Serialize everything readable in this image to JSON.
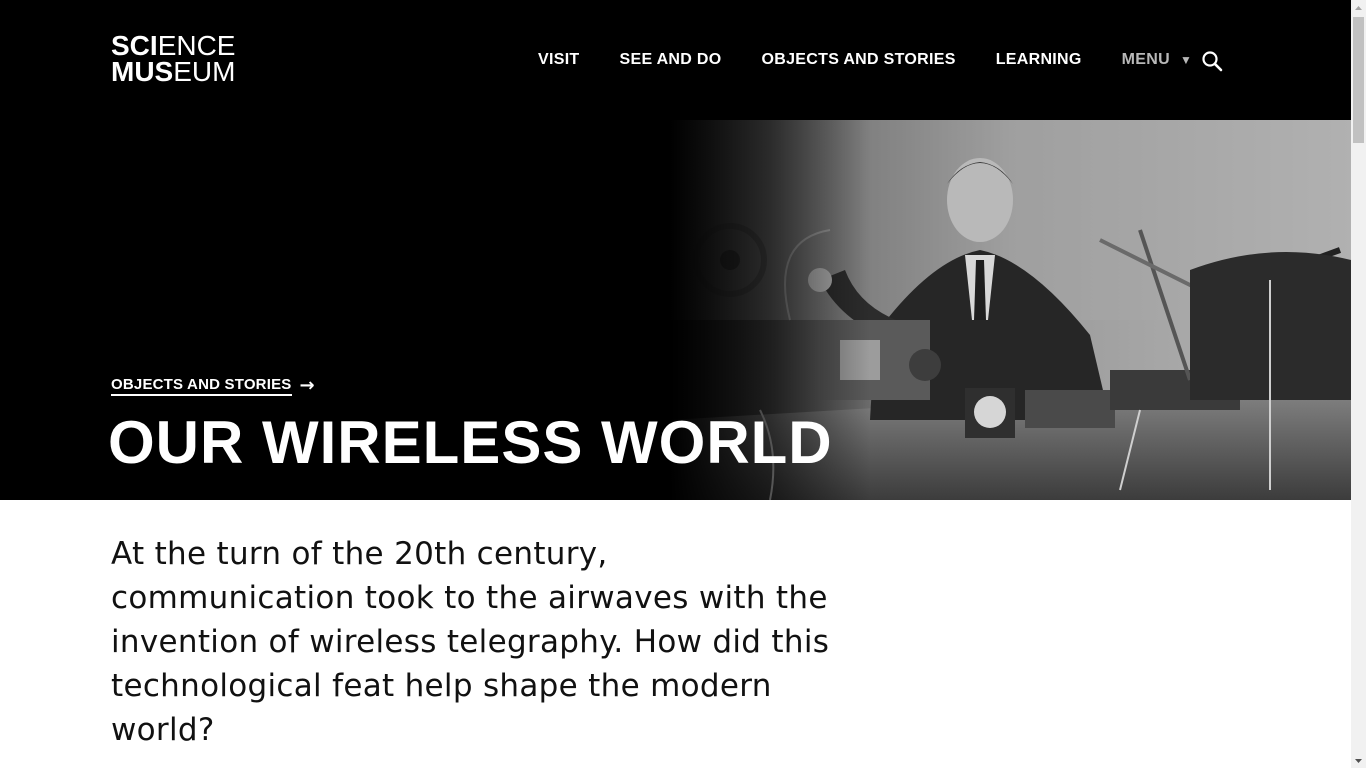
{
  "header": {
    "logo": {
      "line1_bold": "SCI",
      "line1_light": "ENCE",
      "line2_bold": "MUS",
      "line2_light": "EUM"
    },
    "nav": {
      "visit": "VISIT",
      "see_and_do": "SEE AND DO",
      "objects_and_stories": "OBJECTS AND STORIES",
      "learning": "LEARNING",
      "menu": "MENU",
      "menu_icon": "caret-down-icon"
    },
    "search_icon": "search-icon"
  },
  "hero": {
    "breadcrumb_label": "OBJECTS AND STORIES",
    "breadcrumb_arrow": "→",
    "title": "OUR WIRELESS WORLD",
    "photo": "black-and-white photograph of a man seated at a desk with wireless telegraphy apparatus"
  },
  "intro": {
    "text": "At the turn of the 20th century, communication took to the airwaves with the invention of wireless telegraphy. How did this technological feat help shape the modern world?"
  },
  "colors": {
    "header_bg": "#000000",
    "text_light": "#ffffff",
    "menu_muted": "#b8b8b8",
    "body_text": "#111111",
    "scrollbar_track": "#f1f1f1",
    "scrollbar_thumb": "#c1c1c1"
  }
}
